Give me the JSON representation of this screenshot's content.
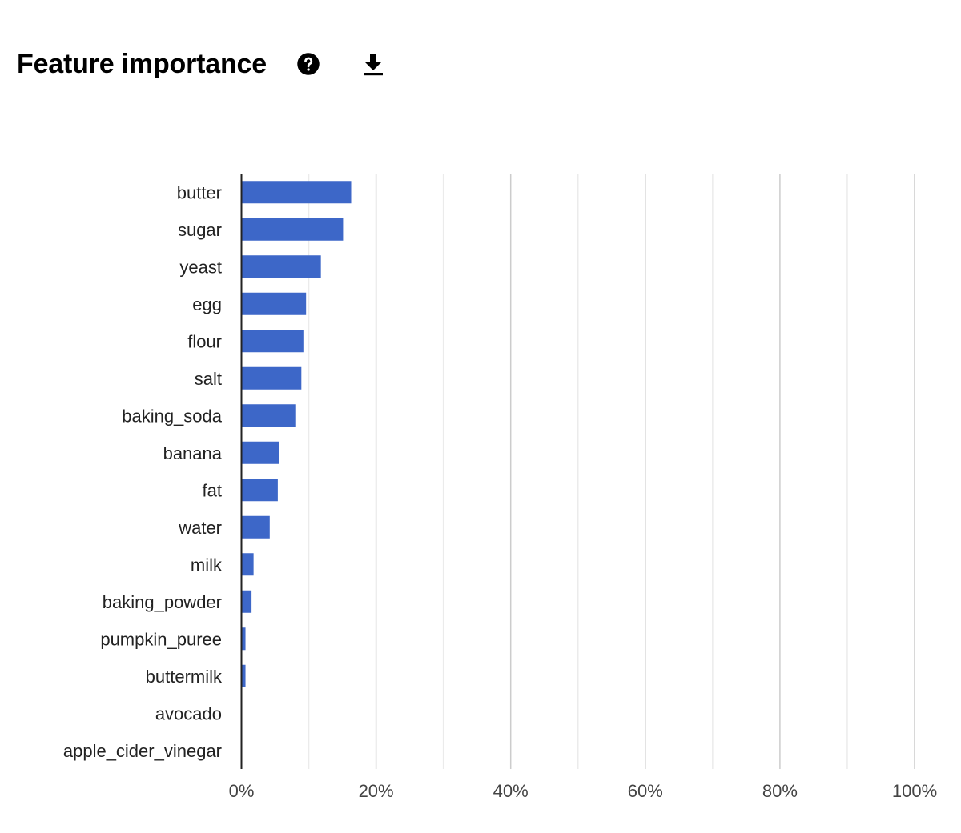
{
  "header": {
    "title": "Feature importance",
    "help_icon": "help-circle-icon",
    "download_icon": "download-icon"
  },
  "chart_data": {
    "type": "bar",
    "orientation": "horizontal",
    "title": "Feature importance",
    "xlabel": "",
    "ylabel": "",
    "categories": [
      "butter",
      "sugar",
      "yeast",
      "egg",
      "flour",
      "salt",
      "baking_soda",
      "banana",
      "fat",
      "water",
      "milk",
      "baking_powder",
      "pumpkin_puree",
      "buttermilk",
      "avocado",
      "apple_cider_vinegar"
    ],
    "values": [
      16.3,
      15.1,
      11.8,
      9.6,
      9.2,
      8.9,
      8.0,
      5.6,
      5.4,
      4.2,
      1.8,
      1.5,
      0.6,
      0.6,
      0,
      0
    ],
    "unit": "%",
    "xlim": [
      0,
      100
    ],
    "x_ticks": [
      "0%",
      "20%",
      "40%",
      "60%",
      "80%",
      "100%"
    ],
    "x_tick_values": [
      0,
      20,
      40,
      60,
      80,
      100
    ],
    "minor_gridlines": [
      10,
      30,
      50,
      70,
      90
    ],
    "grid": true,
    "legend": "none",
    "bar_color": "#3d67c8",
    "major_grid_color": "#cccccc",
    "minor_grid_color": "#ebebeb",
    "axis_color": "#222222"
  }
}
